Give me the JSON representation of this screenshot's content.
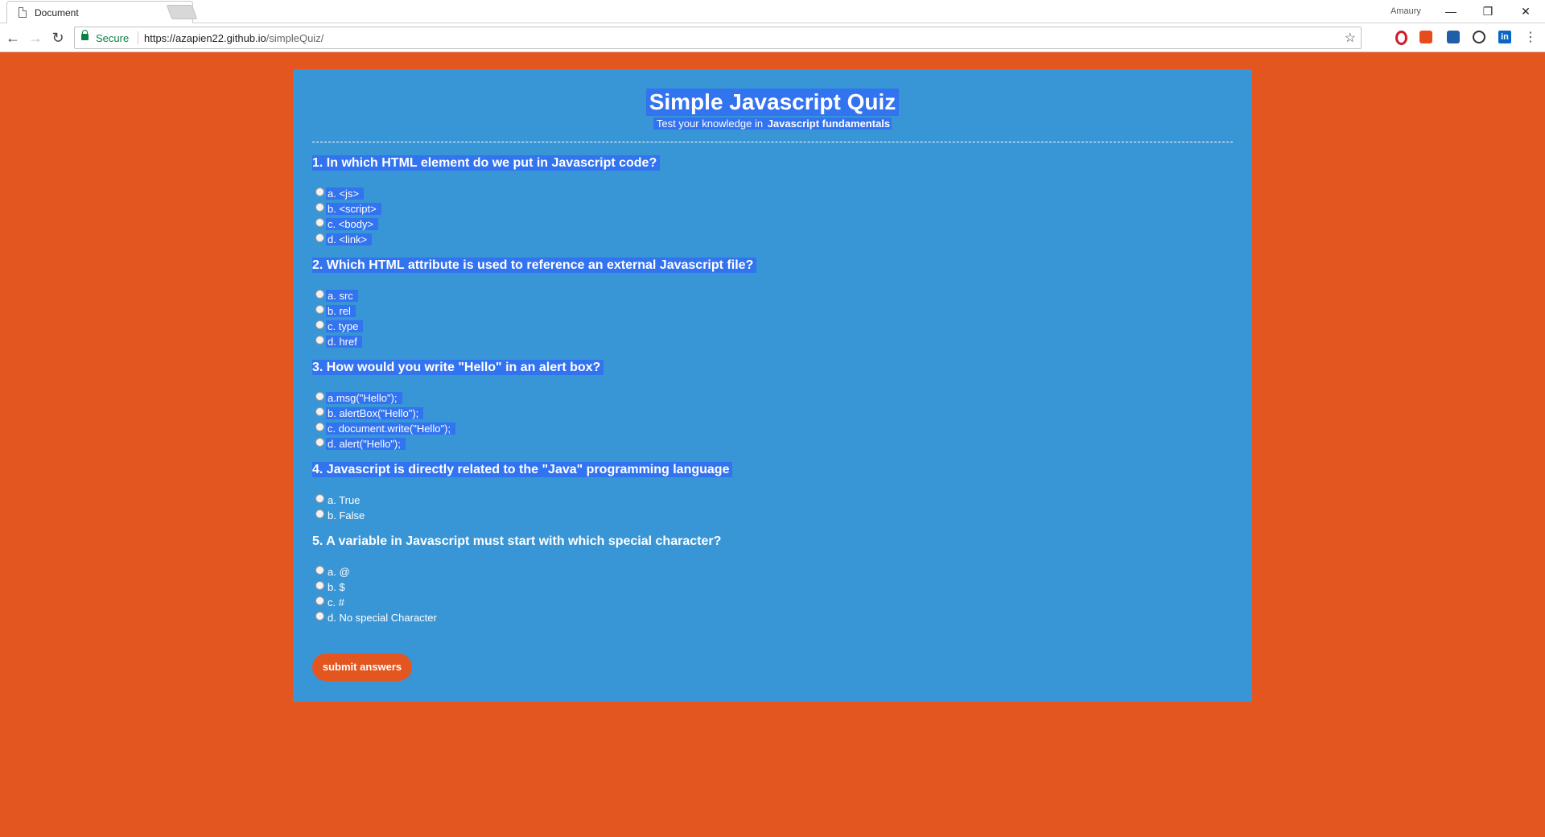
{
  "browser": {
    "tab_title": "Document",
    "tab_close": "✕",
    "profile_name": "Amaury",
    "win_min": "—",
    "win_restore": "❐",
    "win_close": "✕",
    "secure_label": "Secure",
    "url_host": "https://azapien22.github.io",
    "url_path": "/simpleQuiz/",
    "ext_linkedin": "in"
  },
  "quiz": {
    "title": "Simple Javascript Quiz",
    "subtitle_prefix": "Test your knowledge in ",
    "subtitle_bold": "Javascript fundamentals",
    "questions": [
      {
        "text": "1. In which HTML element do we put in Javascript code?",
        "answers": [
          "a. <js>",
          "b. <script>",
          "c. <body>",
          "d. <link>"
        ]
      },
      {
        "text": "2. Which HTML attribute is used to reference an external Javascript file?",
        "answers": [
          "a. src",
          "b. rel",
          "c. type",
          "d. href"
        ]
      },
      {
        "text": "3. How would you write \"Hello\" in an alert box?",
        "answers": [
          "a.msg(\"Hello\");",
          "b. alertBox(\"Hello\");",
          "c. document.write(\"Hello\");",
          "d. alert(\"Hello\");"
        ]
      },
      {
        "text": "4. Javascript is directly related to the \"Java\" programming language",
        "answers": [
          "a. True",
          "b. False"
        ]
      },
      {
        "text": "5. A variable in Javascript must start with which special character?",
        "answers": [
          "a. @",
          "b. $",
          "c. #",
          "d. No special Character"
        ]
      }
    ],
    "submit_label": "submit answers"
  },
  "colors": {
    "page_background": "#e4561f",
    "quiz_background": "#3896d7",
    "selection_highlight": "#3273f0",
    "submit_button": "#e4561f"
  }
}
